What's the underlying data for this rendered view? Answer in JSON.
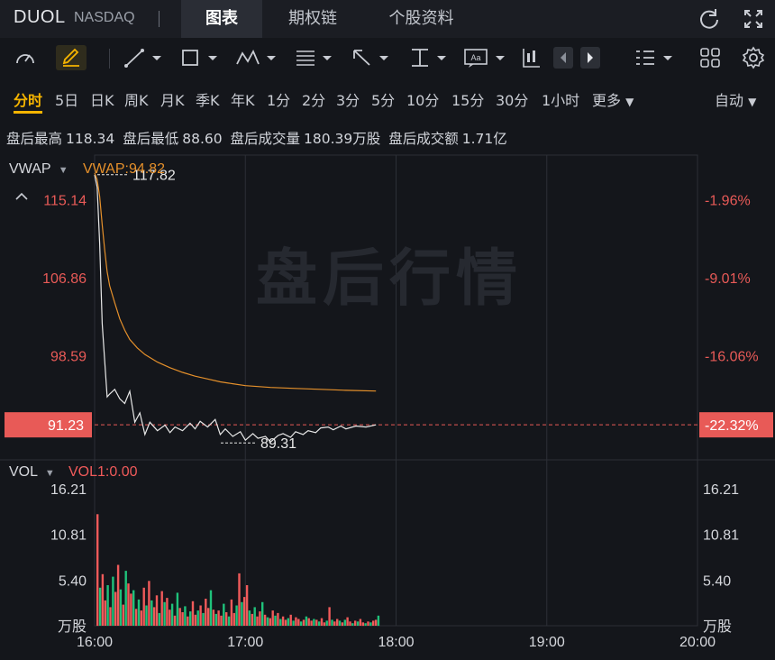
{
  "header": {
    "ticker": "DUOL",
    "exchange": "NASDAQ",
    "tabs": [
      {
        "label": "图表",
        "active": true
      },
      {
        "label": "期权链",
        "active": false
      },
      {
        "label": "个股资料",
        "active": false
      }
    ],
    "icons": [
      "refresh-icon",
      "fullscreen-icon"
    ]
  },
  "toolbar": {
    "icons": [
      "gauge-icon",
      "pen-icon",
      "line-tool-icon",
      "rectangle-tool-icon",
      "pattern-tool-icon",
      "fibonacci-tool-icon",
      "arrow-tool-icon",
      "measure-tool-icon",
      "text-tool-icon",
      "candle-tool-icon",
      "prev-icon",
      "next-icon",
      "layout-list-icon",
      "grid-icon",
      "settings-icon"
    ]
  },
  "periods": {
    "items": [
      "分时",
      "5日",
      "日K",
      "周K",
      "月K",
      "季K",
      "年K",
      "1分",
      "2分",
      "3分",
      "5分",
      "10分",
      "15分",
      "30分",
      "1小时",
      "更多"
    ],
    "active": "分时",
    "mode": "自动"
  },
  "info": {
    "items": [
      {
        "label": "盘后最高",
        "value": "118.34"
      },
      {
        "label": "盘后最低",
        "value": "88.60"
      },
      {
        "label": "盘后成交量",
        "value": "180.39万股"
      },
      {
        "label": "盘后成交额",
        "value": "1.71亿"
      }
    ]
  },
  "chart_data": {
    "type": "line",
    "watermark": "盘后行情",
    "indicator": {
      "name": "VWAP",
      "label": "VWAP:94.82"
    },
    "x_ticks": [
      "16:00",
      "17:00",
      "18:00",
      "19:00",
      "20:00"
    ],
    "xlim": [
      "16:00",
      "20:00"
    ],
    "ylim": [
      87.7,
      119.9
    ],
    "y_ticks_left": [
      "115.14",
      "106.86",
      "98.59"
    ],
    "y_ticks_right": [
      "-1.96%",
      "-9.01%",
      "-16.06%"
    ],
    "current_price": "91.23",
    "current_change": "-22.32%",
    "current_value": 91.23,
    "high_label": "117.82",
    "high_value": 117.82,
    "low_label": "89.31",
    "low_value": 89.31,
    "series": [
      {
        "name": "price",
        "color": "#e8e8e8",
        "x": [
          0,
          1,
          2,
          3,
          4,
          5,
          6,
          8,
          10,
          12,
          14,
          16,
          18,
          20,
          22,
          25,
          28,
          30,
          32,
          35,
          38,
          40,
          42,
          45,
          48,
          50,
          52,
          55,
          58,
          60,
          63,
          65,
          68,
          70,
          73,
          75,
          78,
          80,
          83,
          85,
          88,
          90,
          93,
          95,
          98,
          100,
          104,
          108,
          112
        ],
        "y": [
          117.8,
          116.5,
          110.5,
          102.0,
          98.0,
          94.2,
          94.5,
          95.0,
          94.0,
          93.5,
          94.8,
          91.5,
          92.5,
          90.2,
          91.5,
          90.6,
          91.2,
          90.4,
          91.0,
          90.6,
          91.4,
          90.8,
          91.6,
          91.0,
          91.8,
          90.2,
          90.8,
          90.0,
          90.5,
          89.6,
          90.3,
          89.8,
          90.0,
          89.4,
          90.1,
          90.3,
          89.9,
          90.5,
          90.2,
          90.6,
          90.4,
          90.9,
          91.0,
          90.7,
          91.1,
          90.8,
          91.1,
          91.0,
          91.23
        ]
      },
      {
        "name": "VWAP",
        "color": "#e5902b",
        "x": [
          0,
          1,
          2,
          3,
          4,
          5,
          6,
          8,
          10,
          12,
          14,
          17,
          20,
          25,
          30,
          35,
          40,
          45,
          50,
          55,
          60,
          70,
          80,
          90,
          100,
          112
        ],
        "y": [
          118.0,
          117.3,
          115.5,
          112.5,
          109.8,
          107.5,
          106.0,
          104.2,
          102.5,
          101.3,
          100.3,
          99.4,
          98.7,
          97.9,
          97.3,
          96.8,
          96.4,
          96.1,
          95.8,
          95.6,
          95.4,
          95.2,
          95.1,
          95.0,
          94.9,
          94.82
        ]
      }
    ],
    "volume": {
      "indicator": {
        "name": "VOL",
        "label": "VOL1:0.00"
      },
      "unit": "万股",
      "y_ticks": [
        "16.21",
        "10.81",
        "5.40"
      ],
      "ylim": [
        0,
        19.2
      ],
      "values": [
        13.2,
        4.5,
        6.1,
        3.0,
        4.8,
        2.2,
        5.8,
        4.0,
        7.2,
        4.3,
        2.5,
        6.5,
        5.0,
        3.8,
        4.2,
        2.0,
        3.1,
        1.8,
        4.5,
        2.4,
        5.3,
        3.0,
        2.2,
        3.6,
        1.5,
        4.1,
        2.8,
        3.3,
        1.9,
        2.6,
        1.2,
        3.9,
        2.1,
        1.6,
        2.3,
        1.1,
        1.7,
        2.9,
        1.3,
        1.8,
        2.4,
        1.5,
        3.2,
        2.1,
        4.2,
        1.9,
        1.4,
        1.8,
        1.2,
        2.6,
        1.6,
        1.1,
        3.1,
        1.5,
        2.4,
        6.2,
        2.8,
        3.4,
        4.8,
        1.8,
        1.4,
        2.2,
        1.1,
        1.7,
        2.8,
        1.3,
        1.0,
        0.9,
        1.8,
        1.2,
        1.5,
        0.8,
        1.1,
        0.7,
        0.9,
        1.3,
        0.6,
        1.0,
        0.8,
        0.5,
        0.7,
        1.1,
        0.9,
        0.6,
        0.8,
        0.7,
        0.5,
        0.9,
        0.4,
        0.6,
        2.2,
        0.7,
        0.5,
        0.8,
        0.6,
        0.4,
        0.7,
        1.0,
        0.5,
        0.3,
        0.6,
        0.5,
        0.8,
        0.4,
        0.3,
        0.5,
        0.4,
        0.6,
        0.7,
        1.2
      ],
      "up_color": "#1fc27b",
      "down_color": "#f05a5a"
    }
  },
  "colors": {
    "up": "#1fc27b",
    "down": "#f05a5a",
    "accent": "#f5b400",
    "vwap": "#e5902b",
    "price_tag": "#e85a57"
  }
}
